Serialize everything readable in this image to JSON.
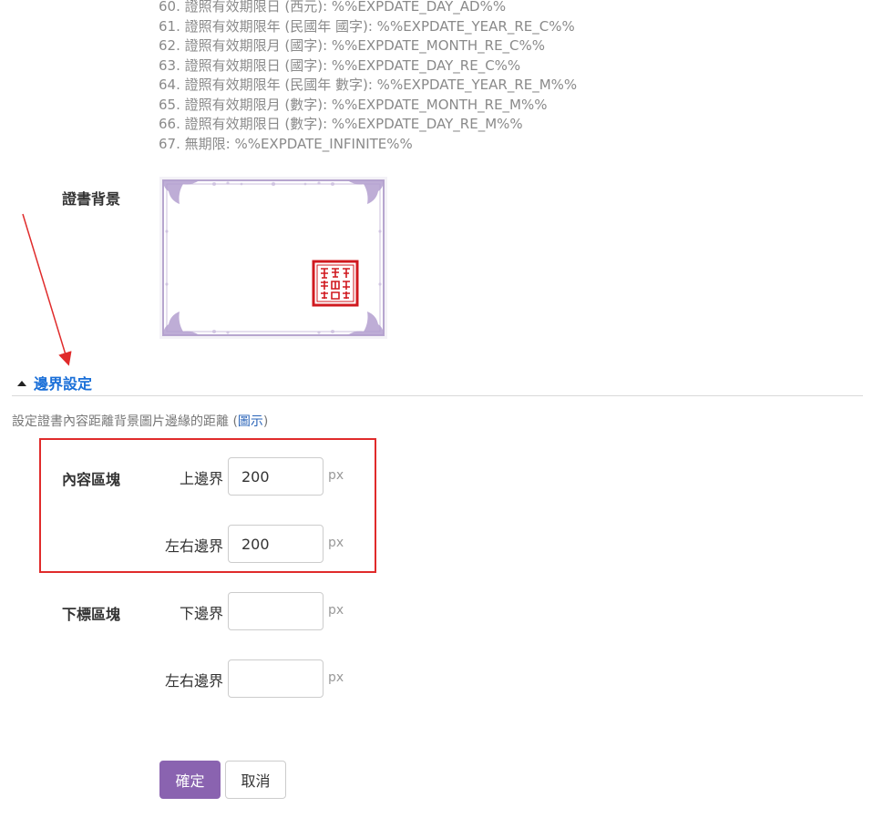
{
  "variables": [
    "60. 證照有效期限日 (西元): %%EXPDATE_DAY_AD%%",
    "61. 證照有效期限年 (民國年 國字): %%EXPDATE_YEAR_RE_C%%",
    "62. 證照有效期限月 (國字): %%EXPDATE_MONTH_RE_C%%",
    "63. 證照有效期限日 (國字): %%EXPDATE_DAY_RE_C%%",
    "64. 證照有效期限年 (民國年 數字): %%EXPDATE_YEAR_RE_M%%",
    "65. 證照有效期限月 (數字): %%EXPDATE_MONTH_RE_M%%",
    "66. 證照有效期限日 (數字): %%EXPDATE_DAY_RE_M%%",
    "67. 無期限: %%EXPDATE_INFINITE%%"
  ],
  "background": {
    "label": "證書背景",
    "seal_text": "臺灣數位學習執行單位上課證明"
  },
  "margin_section": {
    "title": "邊界設定",
    "description": "設定證書內容距離背景圖片邊緣的距離 (",
    "description_link": "圖示",
    "description_end": ")",
    "content_block": {
      "label": "內容區塊",
      "top_label": "上邊界",
      "top_value": "200",
      "side_label": "左右邊界",
      "side_value": "200"
    },
    "footer_block": {
      "label": "下標區塊",
      "bottom_label": "下邊界",
      "bottom_value": "",
      "side_label": "左右邊界",
      "side_value": ""
    },
    "unit": "px"
  },
  "buttons": {
    "confirm": "確定",
    "cancel": "取消"
  },
  "colors": {
    "accent": "#8a63b0",
    "link": "#1a6fd8",
    "highlight": "#e02b2b"
  }
}
